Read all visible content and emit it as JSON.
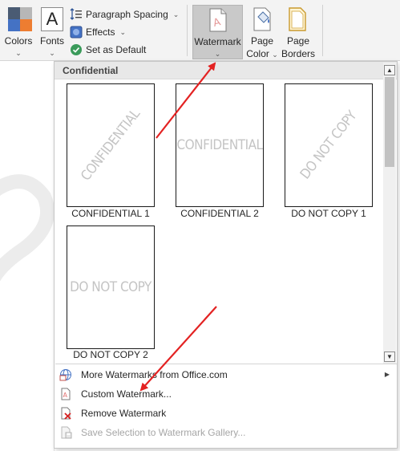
{
  "ribbon": {
    "colors": {
      "label": "Colors",
      "caret": "⌄",
      "swatches": [
        "#4472c4",
        "#ed7d31",
        "#a5a5a5",
        "#ffc000"
      ]
    },
    "fonts": {
      "label": "Fonts",
      "glyph": "A",
      "caret": "⌄"
    },
    "paragraph_spacing": {
      "label": "Paragraph Spacing",
      "caret": "⌄"
    },
    "effects": {
      "label": "Effects",
      "caret": "⌄"
    },
    "set_as_default": {
      "label": "Set as Default"
    },
    "watermark": {
      "label": "Watermark",
      "caret": "⌄"
    },
    "page_color": {
      "line1": "Page",
      "line2": "Color",
      "caret": "⌄"
    },
    "page_borders": {
      "line1": "Page",
      "line2": "Borders"
    }
  },
  "gallery": {
    "header": "Confidential",
    "tiles": [
      {
        "text": "CONFIDENTIAL",
        "caption": "CONFIDENTIAL 1",
        "orientation": "diagonal"
      },
      {
        "text": "CONFIDENTIAL",
        "caption": "CONFIDENTIAL 2",
        "orientation": "horizontal"
      },
      {
        "text": "DO NOT COPY",
        "caption": "DO NOT COPY 1",
        "orientation": "diagonal"
      },
      {
        "text": "DO NOT COPY",
        "caption": "DO NOT COPY 2",
        "orientation": "horizontal"
      }
    ],
    "menu": [
      {
        "label": "More Watermarks from Office.com",
        "icon": "office-globe-icon",
        "submenu": true,
        "enabled": true
      },
      {
        "label": "Custom Watermark...",
        "icon": "custom-watermark-icon",
        "submenu": false,
        "enabled": true
      },
      {
        "label": "Remove Watermark",
        "icon": "remove-watermark-icon",
        "submenu": false,
        "enabled": true
      },
      {
        "label": "Save Selection to Watermark Gallery...",
        "icon": "save-to-gallery-icon",
        "submenu": false,
        "enabled": false
      }
    ],
    "scroll_up": "▲",
    "scroll_down": "▼",
    "submenu_arrow": "▶"
  },
  "colors": {
    "accent_red": "#e32222",
    "ribbon_bg": "#f3f3f3",
    "pressed": "#c9c9c9",
    "disabled_text": "#a6a6a6"
  }
}
